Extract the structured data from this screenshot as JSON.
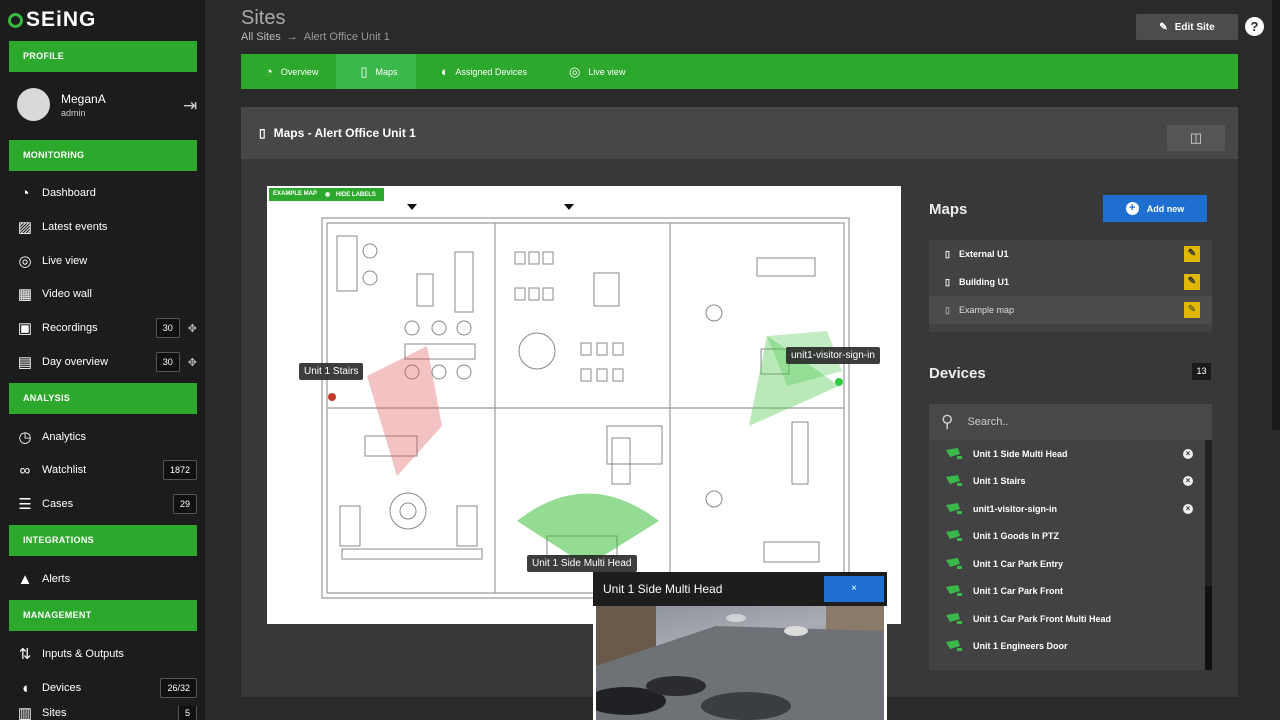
{
  "brand": {
    "logo": "SEiNG"
  },
  "sidebar": {
    "sections": {
      "profile": "PROFILE",
      "monitoring": "MONITORING",
      "analysis": "ANALYSIS",
      "integrations": "INTEGRATIONS",
      "management": "MANAGEMENT"
    },
    "user": {
      "name": "MeganA",
      "role": "admin"
    },
    "items": [
      {
        "label": "Dashboard"
      },
      {
        "label": "Latest events"
      },
      {
        "label": "Live view"
      },
      {
        "label": "Video wall"
      },
      {
        "label": "Recordings",
        "count": "30"
      },
      {
        "label": "Day overview",
        "count": "30"
      },
      {
        "label": "Analytics"
      },
      {
        "label": "Watchlist",
        "count": "1872"
      },
      {
        "label": "Cases",
        "count": "29"
      },
      {
        "label": "Alerts"
      },
      {
        "label": "Inputs & Outputs"
      },
      {
        "label": "Devices",
        "count": "26/32"
      },
      {
        "label": "Sites",
        "count": "5"
      }
    ]
  },
  "header": {
    "title": "Sites",
    "breadcrumb_root": "All Sites",
    "breadcrumb_current": "Alert Office Unit 1",
    "edit_label": "Edit Site",
    "help": "?"
  },
  "tabs": [
    {
      "label": "Overview"
    },
    {
      "label": "Maps"
    },
    {
      "label": "Assigned Devices"
    },
    {
      "label": "Live view"
    }
  ],
  "panel": {
    "title": "Maps - Alert Office Unit 1"
  },
  "map": {
    "tag_example": "EXAMPLE MAP",
    "tag_hide": "HIDE LABELS",
    "labels": {
      "stairs": "Unit 1 Stairs",
      "visitor": "unit1-visitor-sign-in",
      "multihead": "Unit 1 Side Multi Head"
    }
  },
  "maps_section": {
    "title": "Maps",
    "add_label": "Add new",
    "items": [
      {
        "label": "External U1"
      },
      {
        "label": "Building U1"
      },
      {
        "label": "Example map"
      }
    ]
  },
  "devices_section": {
    "title": "Devices",
    "count": "13",
    "search_placeholder": "Search..",
    "items": [
      {
        "label": "Unit 1 Side Multi Head"
      },
      {
        "label": "Unit 1 Stairs"
      },
      {
        "label": "unit1-visitor-sign-in"
      },
      {
        "label": "Unit 1 Goods In PTZ"
      },
      {
        "label": "Unit 1 Car Park Entry"
      },
      {
        "label": "Unit 1 Car Park Front"
      },
      {
        "label": "Unit 1 Car Park Front Multi Head"
      },
      {
        "label": "Unit 1 Engineers Door"
      }
    ]
  },
  "popup": {
    "title": "Unit 1 Side Multi Head",
    "close": "×"
  },
  "colors": {
    "accent": "#2ca82c",
    "primary_button": "#1f6fd1",
    "edit_icon": "#e0b800"
  }
}
